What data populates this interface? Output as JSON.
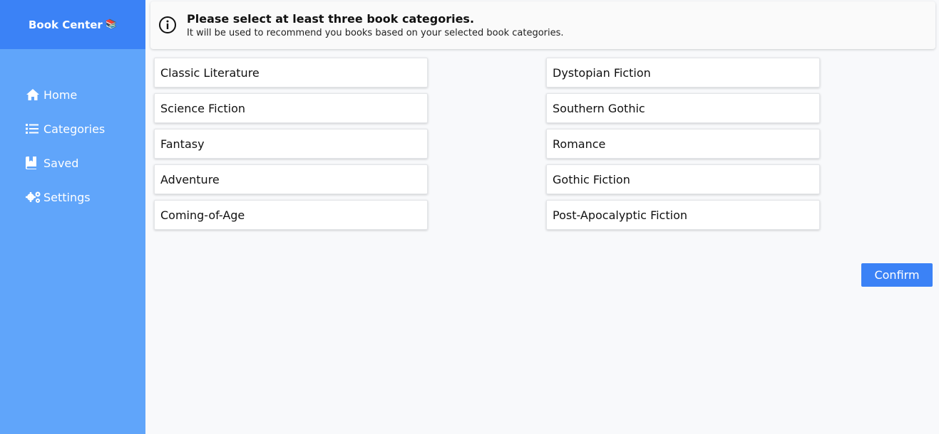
{
  "app": {
    "title": "Book Center",
    "title_emoji": "📚"
  },
  "sidebar": {
    "items": [
      {
        "label": "Home",
        "icon": "home-icon"
      },
      {
        "label": "Categories",
        "icon": "list-icon"
      },
      {
        "label": "Saved",
        "icon": "bookmark-book-icon"
      },
      {
        "label": "Settings",
        "icon": "gears-icon"
      }
    ]
  },
  "banner": {
    "icon": "info-icon",
    "title": "Please select at least three book categories.",
    "subtitle": "It will be used to recommend you books based on your selected book categories."
  },
  "categories": {
    "left": [
      "Classic Literature",
      "Science Fiction",
      "Fantasy",
      "Adventure",
      "Coming-of-Age"
    ],
    "right": [
      "Dystopian Fiction",
      "Southern Gothic",
      "Romance",
      "Gothic Fiction",
      "Post-Apocalyptic Fiction"
    ]
  },
  "actions": {
    "confirm_label": "Confirm"
  },
  "colors": {
    "sidebar": "#60a5fa",
    "brand_bar": "#3b82f6",
    "accent": "#3b82f6",
    "background": "#f8f9fb"
  }
}
